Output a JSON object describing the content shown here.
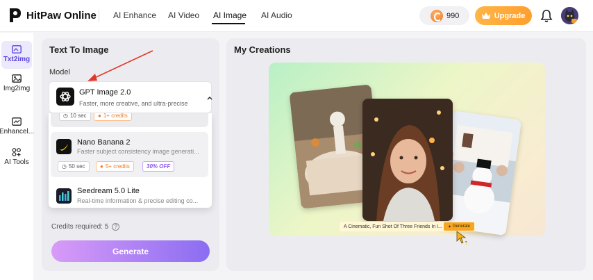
{
  "app": {
    "name": "HitPaw Online"
  },
  "nav": {
    "items": [
      "AI Enhance",
      "AI Video",
      "AI Image",
      "AI Audio"
    ],
    "active": "AI Image"
  },
  "header": {
    "credits": "990",
    "upgrade_label": "Upgrade"
  },
  "sidebar": {
    "items": [
      {
        "label": "Txt2img",
        "icon": "image-text-icon",
        "active": true
      },
      {
        "label": "Img2img",
        "icon": "image-to-image-icon"
      },
      {
        "label": "Enhancel...",
        "icon": "enhance-icon"
      },
      {
        "label": "AI Tools",
        "icon": "ai-tools-icon"
      }
    ]
  },
  "text_to_image": {
    "title": "Text To Image",
    "model_label": "Model",
    "selected_model": {
      "name": "GPT Image 2.0",
      "description": "Faster, more creative, and ultra-precise"
    },
    "dropdown": {
      "partial_item": {
        "time": "10 sec",
        "credits": "1+ credits"
      },
      "items": [
        {
          "name": "Nano Banana 2",
          "description": "Faster subject consistency image generati...",
          "time": "50 sec",
          "credits": "5+ credits",
          "badge": "30% OFF"
        },
        {
          "name": "Seedream 5.0 Lite",
          "description": "Real-time information & precise editing co..."
        }
      ]
    },
    "credits_required": "Credits required: 5",
    "generate_label": "Generate"
  },
  "creations": {
    "title": "My Creations",
    "prompt_text": "A Cinematic, Fun Shot Of Three Friends In I...",
    "generate_label": "Generate"
  },
  "colors": {
    "accent": "#5a43e0",
    "upgrade": "#ffa83a",
    "annotation_arrow": "#e0392b"
  }
}
